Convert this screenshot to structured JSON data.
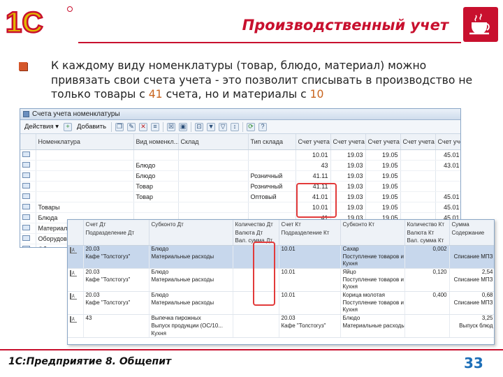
{
  "header": {
    "logo_text": "1С",
    "title": "Производственный учет"
  },
  "intro": {
    "line1": "К каждому виду номенклатуры (товар, блюдо, материал) можно",
    "line2": "привязать свои счета учета - это позволит списывать в производство не",
    "line3_start": "только товары с ",
    "acc_41": "41",
    "line3_mid": " счета, но и материалы с ",
    "acc_10": "10"
  },
  "window1": {
    "title": "Счета учета номенклатуры",
    "toolbar": {
      "actions_label": "Действия ▾",
      "add_label": "Добавить"
    },
    "columns": [
      "",
      "Номенклатура",
      "Вид номенкл...",
      "Склад",
      "Тип склада",
      "Счет учета ...",
      "Счет учета ...",
      "Счет учета ...",
      "Счет учета ...",
      "Счет учета ..."
    ],
    "rows": [
      [
        "",
        "",
        "",
        "",
        "10.01",
        "19.03",
        "19.05",
        "",
        "45.01"
      ],
      [
        "",
        "Блюдо",
        "",
        "",
        "43",
        "19.03",
        "19.05",
        "",
        "43.01"
      ],
      [
        "",
        "Блюдо",
        "",
        "Розничный",
        "41.11",
        "19.03",
        "19.05",
        "",
        ""
      ],
      [
        "",
        "Товар",
        "",
        "Розничный",
        "41.11",
        "19.03",
        "19.05",
        "",
        ""
      ],
      [
        "",
        "Товар",
        "",
        "Оптовый",
        "41.01",
        "19.03",
        "19.05",
        "",
        "45.01"
      ],
      [
        "Товары",
        "",
        "",
        "",
        "10.01",
        "19.03",
        "19.05",
        "",
        "45.01"
      ],
      [
        "Блюда",
        "",
        "",
        "",
        "41",
        "19.03",
        "19.05",
        "",
        "45.01"
      ],
      [
        "Материалы",
        "",
        "",
        "",
        "",
        "",
        "",
        "",
        ""
      ],
      [
        "Оборудование",
        "",
        "",
        "",
        "",
        "",
        "",
        "",
        ""
      ],
      [
        "Оборудование",
        "",
        "",
        "",
        "",
        "",
        "",
        "",
        ""
      ]
    ]
  },
  "window2": {
    "header_row1": [
      "",
      "Счет Дт",
      "Субконто Дт",
      "Количество Дт",
      "Счет Кт",
      "Субконто Кт",
      "Количество Кт",
      "Сумма"
    ],
    "header_row2": [
      "",
      "Подразделение Дт",
      "",
      "Валюта Дт",
      "Подразделение Кт",
      "",
      "Валюта Кт",
      "Содержание"
    ],
    "header_row3": [
      "",
      "",
      "",
      "Вал. сумма Дт",
      "",
      "",
      "Вал. сумма Кт",
      ""
    ],
    "rows": [
      [
        "",
        "20.03",
        "Блюдо",
        "",
        "10.01",
        "Сахар",
        "0,002",
        "",
        "sel"
      ],
      [
        "",
        "Кафе \"Толстогуз\"",
        "Материальные расходы",
        "",
        "",
        "Поступление товаров и ус...",
        "",
        "Списание МПЗ",
        "sel"
      ],
      [
        "",
        "",
        "",
        "",
        "",
        "Кухня",
        "",
        "",
        "end"
      ],
      [
        "",
        "20.03",
        "Блюдо",
        "",
        "10.01",
        "Яйцо",
        "0,120",
        "2,54",
        ""
      ],
      [
        "",
        "Кафе \"Толстогуз\"",
        "Материальные расходы",
        "",
        "",
        "Поступление товаров и ус...",
        "",
        "Списание МПЗ",
        ""
      ],
      [
        "",
        "",
        "",
        "",
        "",
        "Кухня",
        "",
        "",
        "end"
      ],
      [
        "",
        "20.03",
        "Блюдо",
        "",
        "10.01",
        "Корица молотая",
        "0,400",
        "0,68",
        ""
      ],
      [
        "",
        "Кафе \"Толстогуз\"",
        "Материальные расходы",
        "",
        "",
        "Поступление товаров и ус...",
        "",
        "Списание МПЗ",
        ""
      ],
      [
        "",
        "",
        "",
        "",
        "",
        "Кухня",
        "",
        "",
        "end"
      ],
      [
        "",
        "43",
        "Выпечка пирожных",
        "",
        "20.03",
        "Блюдо",
        "",
        "3,25",
        ""
      ],
      [
        "",
        "",
        "Выпуск продукции (ОС/10...",
        "",
        "Кафе \"Толстогуз\"",
        "Материальные расходы",
        "",
        "Выпуск блюд",
        ""
      ],
      [
        "",
        "",
        "Кухня",
        "",
        "",
        "",
        "",
        "",
        "end"
      ]
    ]
  },
  "footer": {
    "product": "1С:Предприятие 8. Общепит",
    "page": "33"
  },
  "colors": {
    "accent": "#c8102e",
    "highlight": "#c8641e",
    "page_num": "#1d6fb8"
  }
}
